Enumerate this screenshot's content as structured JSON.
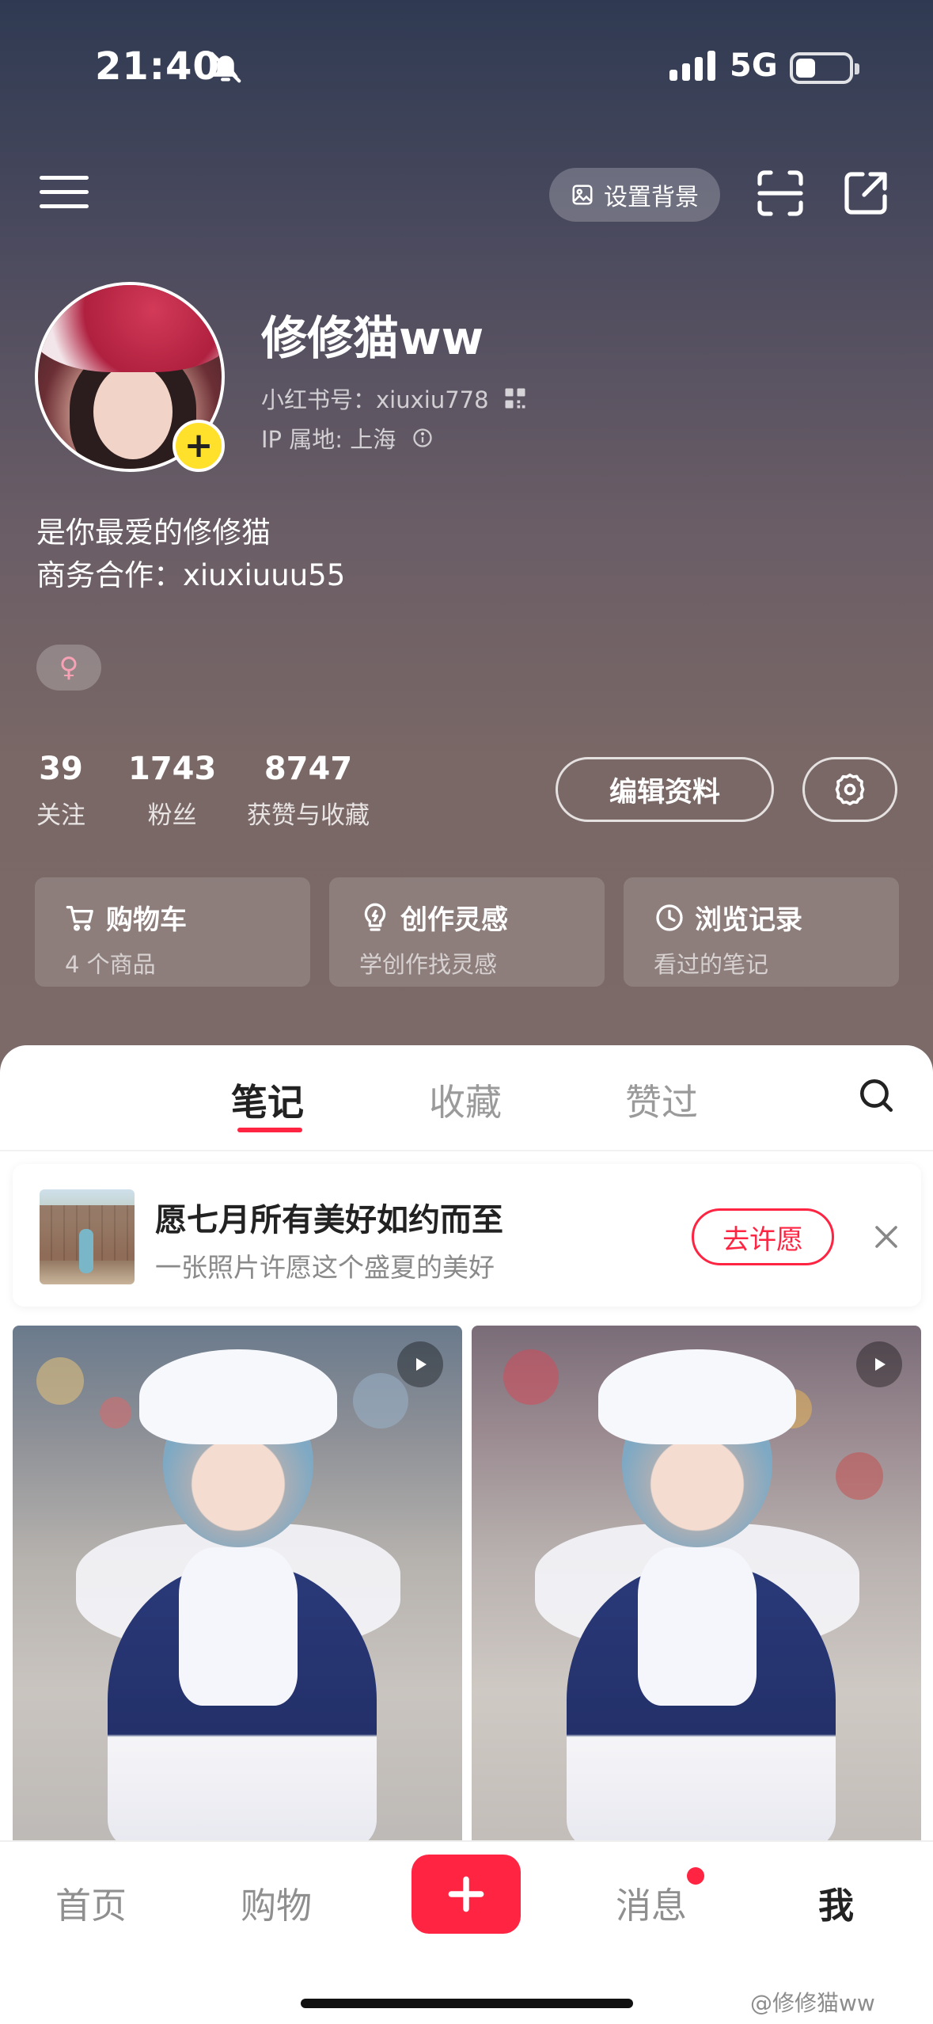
{
  "status_bar": {
    "time": "21:40",
    "network": "5G"
  },
  "top_bar": {
    "set_background_label": "设置背景"
  },
  "profile": {
    "nickname": "修修猫ww",
    "red_id": "小红书号：xiuxiu778",
    "ip_location": "IP 属地: 上海",
    "bio_line1": "是你最爱的修修猫",
    "bio_line2": "商务合作：xiuxiuuu55",
    "gender_symbol": "♀"
  },
  "stats": {
    "following": {
      "value": "39",
      "label": "关注"
    },
    "fans": {
      "value": "1743",
      "label": "粉丝"
    },
    "likes": {
      "value": "8747",
      "label": "获赞与收藏"
    }
  },
  "actions": {
    "edit_label": "编辑资料"
  },
  "cards": [
    {
      "title": "购物车",
      "subtitle": "4 个商品",
      "icon": "cart-icon"
    },
    {
      "title": "创作灵感",
      "subtitle": "学创作找灵感",
      "icon": "bulb-icon"
    },
    {
      "title": "浏览记录",
      "subtitle": "看过的笔记",
      "icon": "clock-icon"
    }
  ],
  "tabs": [
    {
      "label": "笔记",
      "active": true
    },
    {
      "label": "收藏",
      "active": false
    },
    {
      "label": "赞过",
      "active": false
    }
  ],
  "wish_banner": {
    "title": "愿七月所有美好如约而至",
    "subtitle": "一张照片许愿这个盛夏的美好",
    "button": "去许愿"
  },
  "bottom_nav": {
    "home": "首页",
    "shop": "购物",
    "messages": "消息",
    "me": "我"
  },
  "watermark": "@修修猫ww",
  "colors": {
    "accent": "#ff2442",
    "badge_yellow": "#ffe02b"
  }
}
